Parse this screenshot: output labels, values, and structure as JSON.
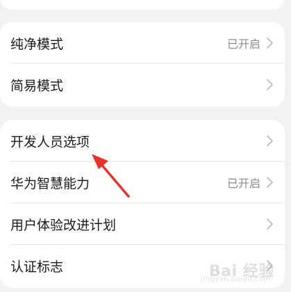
{
  "settings": {
    "group1": [
      {
        "label": "纯净模式",
        "value": "已开启"
      },
      {
        "label": "简易模式",
        "value": ""
      }
    ],
    "group2": [
      {
        "label": "开发人员选项",
        "value": ""
      },
      {
        "label": "华为智慧能力",
        "value": "已开启"
      },
      {
        "label": "用户体验改进计划",
        "value": ""
      },
      {
        "label": "认证标志",
        "value": ""
      }
    ]
  },
  "watermark": {
    "brand": "Bai 经验",
    "sub": "jingyan.baidu.com"
  },
  "colors": {
    "background": "#f1f2f4",
    "card": "#ffffff",
    "annotation_arrow": "#e5322d"
  }
}
